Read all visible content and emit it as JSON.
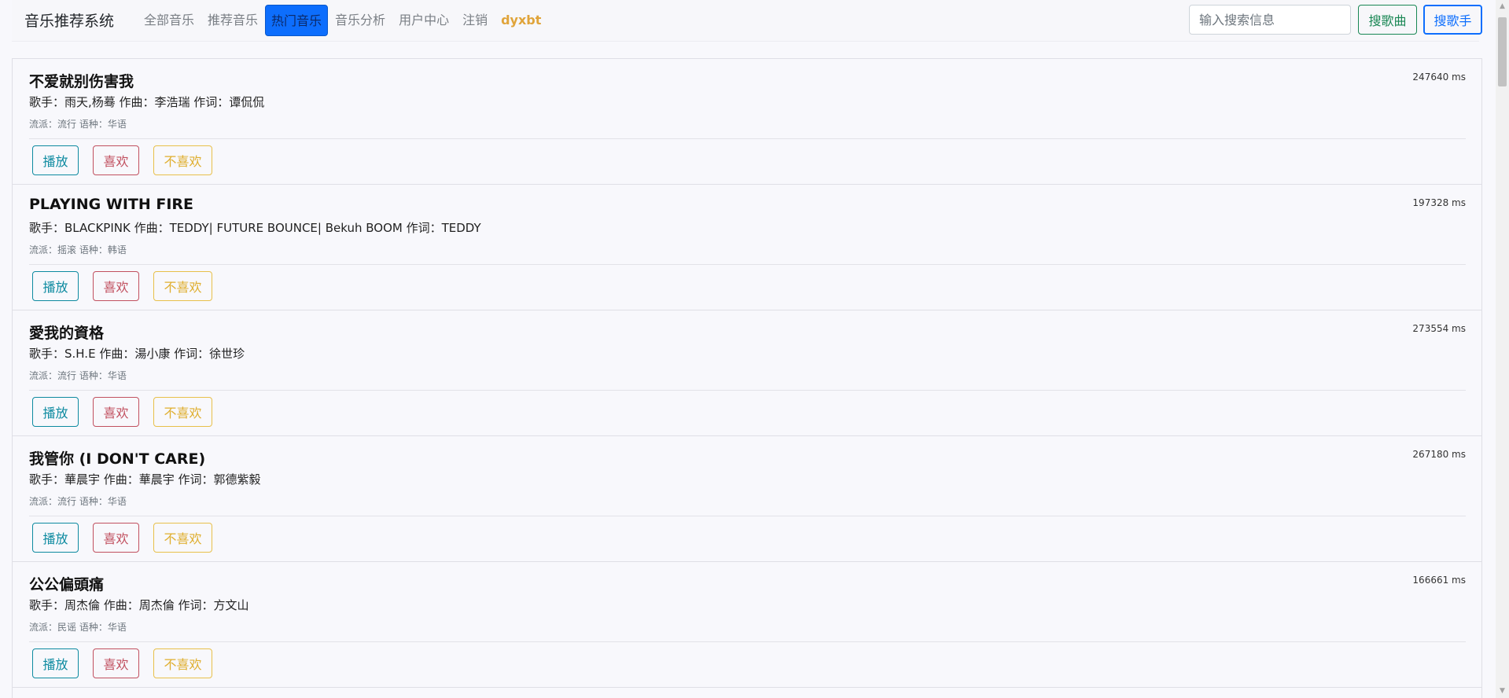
{
  "navbar": {
    "brand": "音乐推荐系统",
    "links": [
      "全部音乐",
      "推荐音乐",
      "热门音乐",
      "音乐分析",
      "用户中心",
      "注销"
    ],
    "active_index": 2,
    "user": "dyxbt",
    "search_placeholder": "输入搜索信息",
    "search_song_label": "搜歌曲",
    "search_singer_label": "搜歌手"
  },
  "songs": [
    {
      "title": "不爱就别伤害我",
      "meta": "歌手：雨天,杨蓦 作曲：李浩瑞 作词：谭侃侃",
      "tags": "流派：流行 语种：华语",
      "duration": "247640 ms"
    },
    {
      "title": "PLAYING WITH FIRE",
      "meta": "歌手：BLACKPINK 作曲：TEDDY| FUTURE BOUNCE| Bekuh BOOM 作词：TEDDY",
      "tags": "流派：摇滚 语种：韩语",
      "duration": "197328 ms"
    },
    {
      "title": "愛我的資格",
      "meta": "歌手：S.H.E 作曲：湯小康 作词：徐世珍",
      "tags": "流派：流行 语种：华语",
      "duration": "273554 ms"
    },
    {
      "title": "我管你 (I DON'T CARE)",
      "meta": "歌手：華晨宇 作曲：華晨宇 作词：郭德紫毅",
      "tags": "流派：流行 语种：华语",
      "duration": "267180 ms"
    },
    {
      "title": "公公偏頭痛",
      "meta": "歌手：周杰倫 作曲：周杰倫 作词：方文山",
      "tags": "流派：民谣 语种：华语",
      "duration": "166661 ms"
    }
  ],
  "actions": {
    "play": "播放",
    "like": "喜欢",
    "dislike": "不喜欢"
  },
  "scrollbar": {
    "up_icon": "▲",
    "down_icon": "▼"
  }
}
